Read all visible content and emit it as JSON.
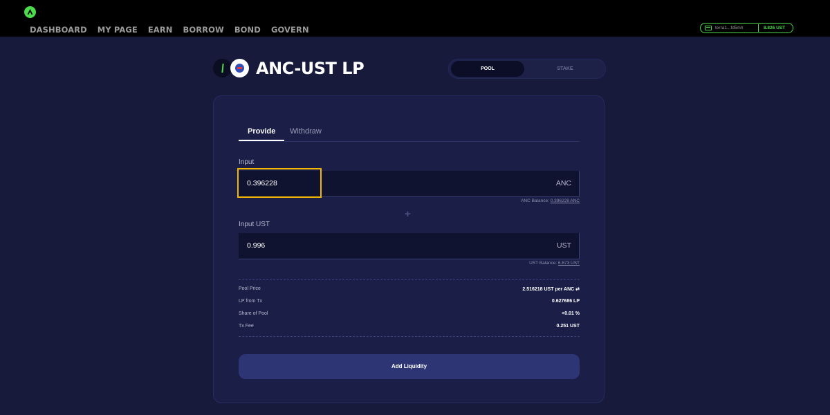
{
  "nav": {
    "items": [
      "DASHBOARD",
      "MY PAGE",
      "EARN",
      "BORROW",
      "BOND",
      "GOVERN"
    ]
  },
  "wallet": {
    "address": "terra1...fd5mh",
    "balance": "8.826 UST"
  },
  "title": "ANC-UST LP",
  "segment": {
    "pool": "POOL",
    "stake": "STAKE"
  },
  "tabs": {
    "provide": "Provide",
    "withdraw": "Withdraw"
  },
  "input_anc": {
    "label": "Input",
    "value": "0.396228",
    "unit": "ANC",
    "balance_label": "ANC Balance:",
    "balance_value": "0.396228 ANC"
  },
  "plus": "+",
  "input_ust": {
    "label": "Input UST",
    "value": "0.996",
    "unit": "UST",
    "balance_label": "UST Balance:",
    "balance_value": "6.673 UST"
  },
  "summary": [
    {
      "label": "Pool Price",
      "value": "2.516218 UST per ANC ⇄"
    },
    {
      "label": "LP from Tx",
      "value": "0.627686 LP"
    },
    {
      "label": "Share of Pool",
      "value": "<0.01 %"
    },
    {
      "label": "Tx Fee",
      "value": "0.251 UST"
    }
  ],
  "action": {
    "label": "Add Liquidity"
  },
  "colors": {
    "background": "#171a3b",
    "card": "#1b1f47",
    "accent_green": "#4bdb4b",
    "highlight": "#f5b800",
    "button": "#2e3575"
  }
}
